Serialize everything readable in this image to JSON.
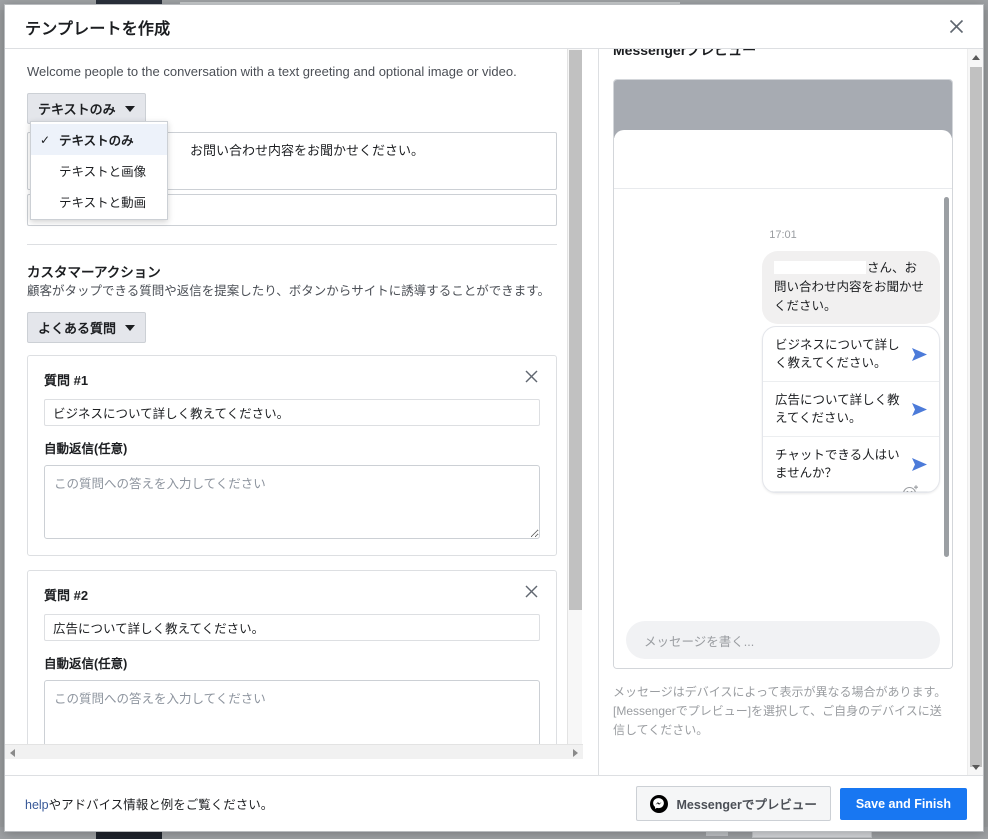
{
  "dialog": {
    "title": "テンプレートを作成",
    "close_icon": "close-icon"
  },
  "left_panel": {
    "welcome_description": "Welcome people to the conversation with a text greeting and optional image or video.",
    "media_select": {
      "value": "テキストのみ",
      "open": true,
      "options": [
        {
          "label": "テキストのみ",
          "selected": true
        },
        {
          "label": "テキストと画像",
          "selected": false
        },
        {
          "label": "テキストと動画",
          "selected": false
        }
      ]
    },
    "greeting_text": "お問い合わせ内容をお聞かせください。",
    "customer_action": {
      "title": "カスタマーアクション",
      "description": "顧客がタップできる質問や返信を提案したり、ボタンからサイトに誘導することができます。",
      "type_select": {
        "value": "よくある質問"
      }
    },
    "questions": [
      {
        "heading": "質問 #1",
        "question_value": "ビジネスについて詳しく教えてください。",
        "reply_label": "自動返信(任意)",
        "reply_placeholder": "この質問への答えを入力してください",
        "reply_value": "",
        "remove_icon": "close-icon"
      },
      {
        "heading": "質問 #2",
        "question_value": "広告について詳しく教えてください。",
        "reply_label": "自動返信(任意)",
        "reply_placeholder": "この質問への答えを入力してください",
        "reply_value": "",
        "remove_icon": "close-icon"
      }
    ]
  },
  "preview_panel": {
    "title": "Messengerプレビュー",
    "chat": {
      "timestamp": "17:01",
      "greeting_bubble": "さん、お問い合わせ内容をお聞かせください。",
      "quick_replies": [
        {
          "text": "ビジネスについて詳しく教えてください。",
          "icon": "send-icon"
        },
        {
          "text": "広告について詳しく教えてください。",
          "icon": "send-icon"
        },
        {
          "text": "チャットできる人はいませんか？",
          "icon": "send-icon"
        }
      ],
      "reaction_icon": "emoji-add-icon",
      "composer_placeholder": "メッセージを書く..."
    },
    "note": "メッセージはデバイスによって表示が異なる場合があります。[Messengerでプレビュー]を選択して、ご自身のデバイスに送信してください。"
  },
  "footer": {
    "help_link": "help",
    "note_rest": "やアドバイス情報と例をご覧ください。",
    "messenger_preview_button": "Messengerでプレビュー",
    "messenger_icon": "messenger-icon",
    "save_button": "Save and Finish"
  },
  "colors": {
    "primary": "#1877f2",
    "link": "#385898",
    "bubble_bg": "#f1f0f0",
    "send_arrow": "#4c7bd9",
    "phone_header": "#a7abb2"
  }
}
